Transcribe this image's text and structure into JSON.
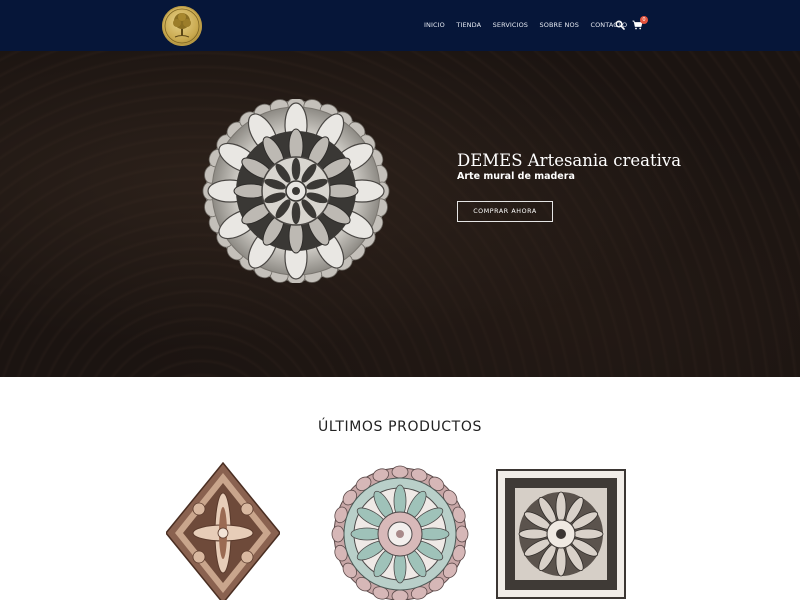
{
  "header": {
    "logo_alt": "DEMES tree of life logo",
    "nav": [
      "INICIO",
      "TIENDA",
      "SERVICIOS",
      "SOBRE NOS",
      "CONTACTO"
    ],
    "cart_count": "0",
    "icons": [
      "search-icon",
      "cart-icon"
    ]
  },
  "hero": {
    "title": "DEMES Artesania creativa",
    "subtitle": "Arte mural de madera",
    "button_label": "COMPRAR AHORA"
  },
  "products_section": {
    "title": "ÚLTIMOS PRODUCTOS",
    "products": [
      {
        "name": "diamond-wood-mandala"
      },
      {
        "name": "round-pastel-mandala"
      },
      {
        "name": "square-dark-mandala"
      }
    ]
  },
  "colors": {
    "header_bg": "#061639",
    "hero_bg": "#1a1310",
    "badge": "#e5533d",
    "logo_gold": "#c9a94f"
  }
}
